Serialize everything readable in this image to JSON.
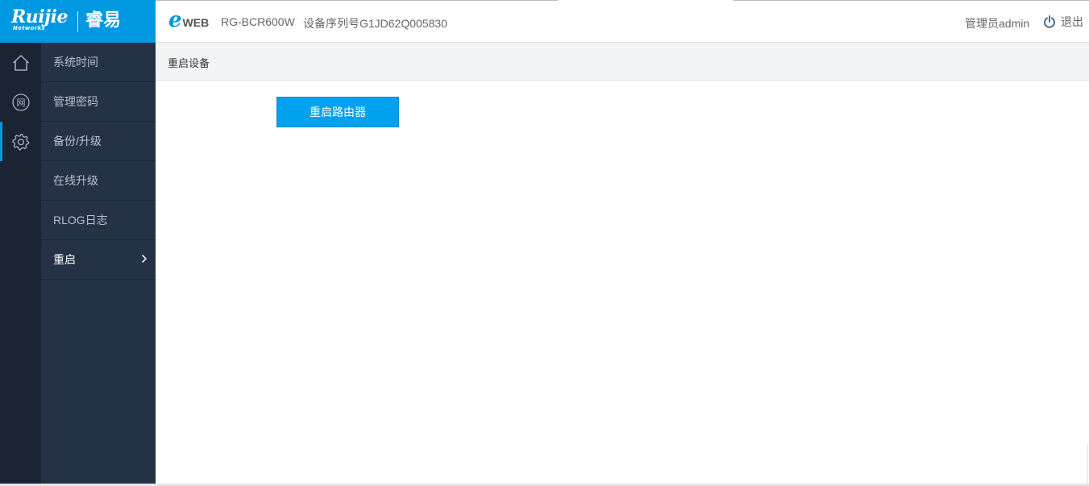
{
  "header": {
    "brand": "Ruijie",
    "brand_sub": "Networks",
    "brand_cn": "睿易",
    "eweb_e": "e",
    "eweb_rest": "WEB",
    "model": "RG-BCR600W",
    "serial": "设备序列号G1JD62Q005830",
    "admin": "管理员admin",
    "logout": "退出"
  },
  "rail": {
    "items": [
      {
        "icon": "home-icon"
      },
      {
        "icon": "network-icon",
        "glyph": "网"
      },
      {
        "icon": "gear-icon",
        "active": true
      }
    ]
  },
  "submenu": {
    "items": [
      {
        "label": "系统时间"
      },
      {
        "label": "管理密码"
      },
      {
        "label": "备份/升级"
      },
      {
        "label": "在线升级"
      },
      {
        "label": "RLOG日志"
      },
      {
        "label": "重启",
        "active": true
      }
    ]
  },
  "content": {
    "title": "重启设备",
    "reboot_button": "重启路由器"
  },
  "colors": {
    "accent": "#0098e0",
    "button": "#00a2f0",
    "rail_bg": "#1a2433",
    "submenu_bg": "#253246"
  }
}
